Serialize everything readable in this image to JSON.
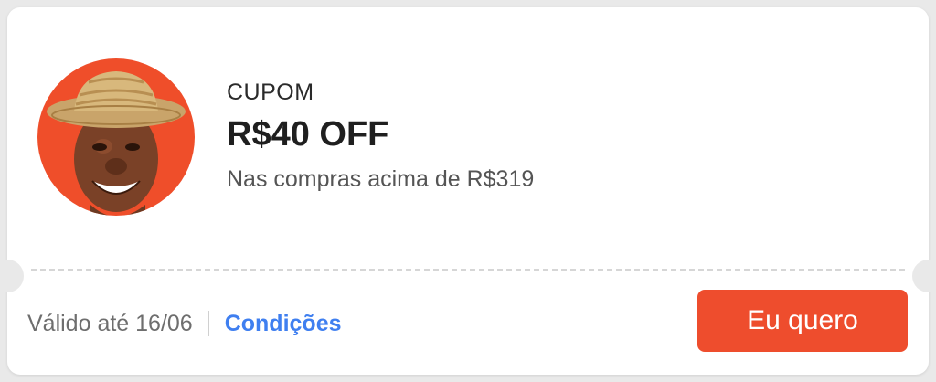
{
  "coupon": {
    "label": "CUPOM",
    "amount": "R$40 OFF",
    "condition": "Nas compras acima de R$319"
  },
  "footer": {
    "valid_text": "Válido até 16/06",
    "conditions_link": "Condições"
  },
  "cta": {
    "label": "Eu quero"
  },
  "avatar": {
    "icon": "smiling-man-straw-hat-avatar"
  },
  "colors": {
    "brand": "#ee4d2d",
    "link": "#3f7ff0"
  }
}
